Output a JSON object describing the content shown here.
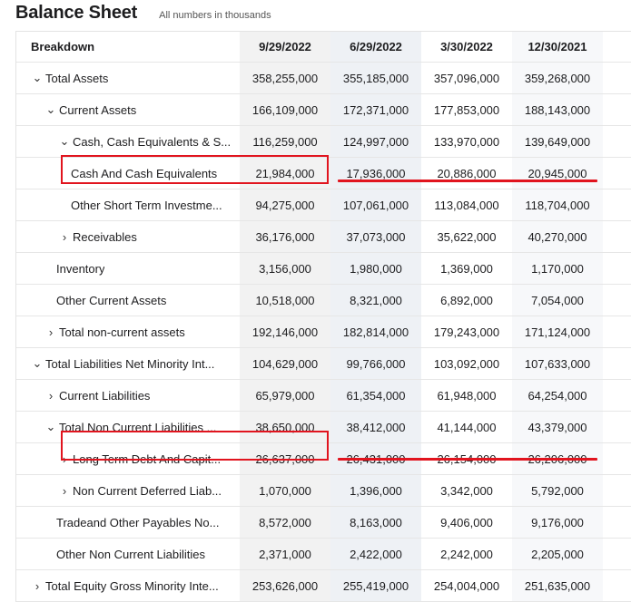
{
  "header": {
    "title": "Balance Sheet",
    "subtitle": "All numbers in thousands"
  },
  "columns": [
    "Breakdown",
    "9/29/2022",
    "6/29/2022",
    "3/30/2022",
    "12/30/2021"
  ],
  "rows": [
    {
      "label": "Total Assets",
      "chevron": "down",
      "values": [
        "358,255,000",
        "355,185,000",
        "357,096,000",
        "359,268,000"
      ]
    },
    {
      "label": "Current Assets",
      "chevron": "down",
      "values": [
        "166,109,000",
        "172,371,000",
        "177,853,000",
        "188,143,000"
      ]
    },
    {
      "label": "Cash, Cash Equivalents & S...",
      "chevron": "down",
      "values": [
        "116,259,000",
        "124,997,000",
        "133,970,000",
        "139,649,000"
      ]
    },
    {
      "label": "Cash And Cash Equivalents",
      "chevron": "",
      "values": [
        "21,984,000",
        "17,936,000",
        "20,886,000",
        "20,945,000"
      ]
    },
    {
      "label": "Other Short Term Investme...",
      "chevron": "",
      "values": [
        "94,275,000",
        "107,061,000",
        "113,084,000",
        "118,704,000"
      ]
    },
    {
      "label": "Receivables",
      "chevron": "right",
      "values": [
        "36,176,000",
        "37,073,000",
        "35,622,000",
        "40,270,000"
      ]
    },
    {
      "label": "Inventory",
      "chevron": "",
      "values": [
        "3,156,000",
        "1,980,000",
        "1,369,000",
        "1,170,000"
      ]
    },
    {
      "label": "Other Current Assets",
      "chevron": "",
      "values": [
        "10,518,000",
        "8,321,000",
        "6,892,000",
        "7,054,000"
      ]
    },
    {
      "label": "Total non-current assets",
      "chevron": "right",
      "values": [
        "192,146,000",
        "182,814,000",
        "179,243,000",
        "171,124,000"
      ]
    },
    {
      "label": "Total Liabilities Net Minority Int...",
      "chevron": "down",
      "values": [
        "104,629,000",
        "99,766,000",
        "103,092,000",
        "107,633,000"
      ]
    },
    {
      "label": "Current Liabilities",
      "chevron": "right",
      "values": [
        "65,979,000",
        "61,354,000",
        "61,948,000",
        "64,254,000"
      ]
    },
    {
      "label": "Total Non Current Liabilities ...",
      "chevron": "down",
      "values": [
        "38,650,000",
        "38,412,000",
        "41,144,000",
        "43,379,000"
      ]
    },
    {
      "label": "Long Term Debt And Capit...",
      "chevron": "right",
      "values": [
        "26,637,000",
        "26,431,000",
        "26,154,000",
        "26,206,000"
      ]
    },
    {
      "label": "Non Current Deferred Liab...",
      "chevron": "right",
      "values": [
        "1,070,000",
        "1,396,000",
        "3,342,000",
        "5,792,000"
      ]
    },
    {
      "label": "Tradeand Other Payables No...",
      "chevron": "",
      "values": [
        "8,572,000",
        "8,163,000",
        "9,406,000",
        "9,176,000"
      ]
    },
    {
      "label": "Other Non Current Liabilities",
      "chevron": "",
      "values": [
        "2,371,000",
        "2,422,000",
        "2,242,000",
        "2,205,000"
      ]
    },
    {
      "label": "Total Equity Gross Minority Inte...",
      "chevron": "right",
      "values": [
        "253,626,000",
        "255,419,000",
        "254,004,000",
        "251,635,000"
      ]
    }
  ],
  "annotation_color": "#e1141e"
}
